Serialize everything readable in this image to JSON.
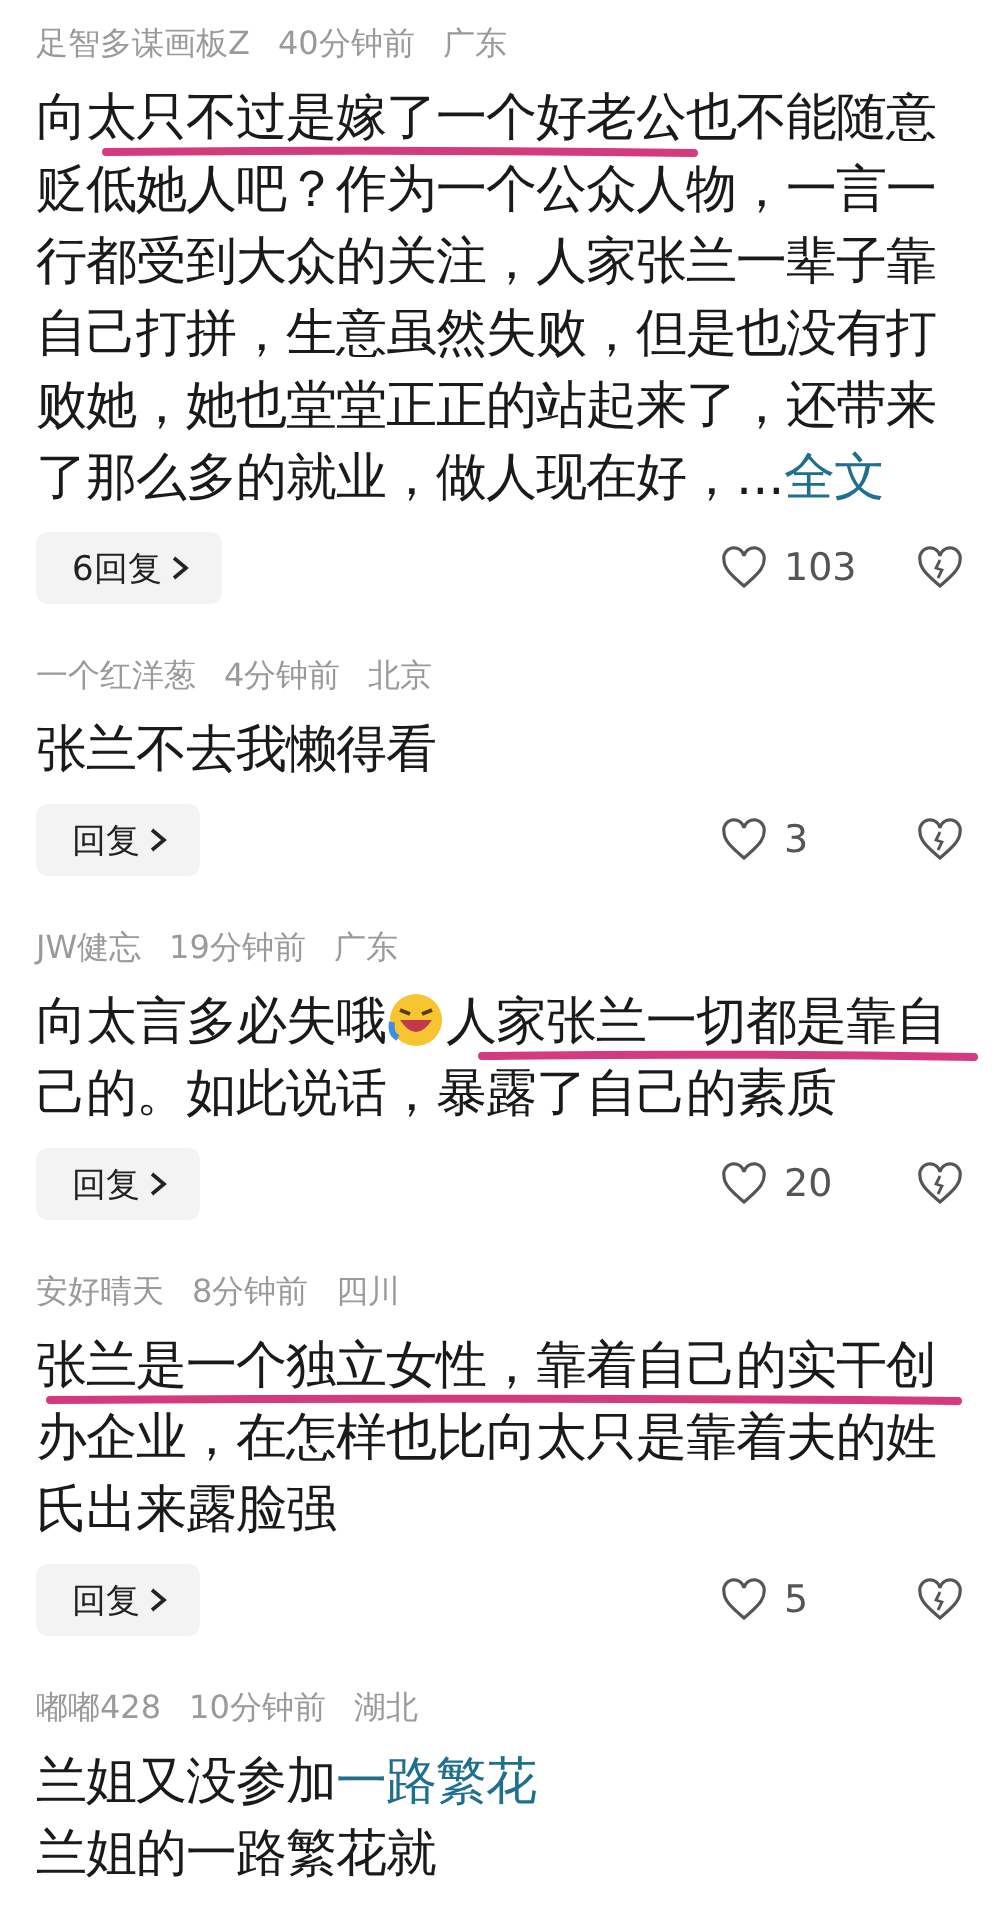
{
  "comments": [
    {
      "user": "足智多谋画板Z",
      "time": "40分钟前",
      "place": "广东",
      "underlined": true,
      "body": [
        {
          "kind": "text",
          "text": "向太只不过是嫁了一个好老公也不能随意贬低她人吧？作为一个公众人物，一言一行都受到大众的关注，人家张兰一辈子靠自己打拼，生意虽然失败，但是也没有打败她，她也堂堂正正的站起来了，还带来了那么多的就业，做人现在好，..."
        },
        {
          "kind": "link",
          "text": "全文"
        }
      ],
      "reply": "6回复",
      "likes": "103"
    },
    {
      "user": "一个红洋葱",
      "time": "4分钟前",
      "place": "北京",
      "underlined": false,
      "body": [
        {
          "kind": "text",
          "text": "张兰不去我懒得看"
        }
      ],
      "reply": "回复",
      "likes": "3"
    },
    {
      "user": "JW健忘",
      "time": "19分钟前",
      "place": "广东",
      "underlined": true,
      "body": [
        {
          "kind": "text",
          "text": "向太言多必失哦"
        },
        {
          "kind": "emoji"
        },
        {
          "kind": "text",
          "text": "人家张兰一切都是靠自己的。如此说话，暴露了自己的素质"
        }
      ],
      "reply": "回复",
      "likes": "20"
    },
    {
      "user": "安好晴天",
      "time": "8分钟前",
      "place": "四川",
      "underlined": true,
      "body": [
        {
          "kind": "text",
          "text": "张兰是一个独立女性，靠着自己的实干创办企业，在怎样也比向太只是靠着夫的姓氏出来露脸强"
        }
      ],
      "reply": "回复",
      "likes": "5"
    },
    {
      "user": "嘟嘟428",
      "time": "10分钟前",
      "place": "湖北",
      "underlined": false,
      "lines": [
        [
          {
            "kind": "text",
            "text": "兰姐又没参加"
          },
          {
            "kind": "link",
            "text": "一路繁花"
          }
        ],
        [
          {
            "kind": "text",
            "text": "兰姐的一路繁花就"
          }
        ]
      ]
    }
  ]
}
